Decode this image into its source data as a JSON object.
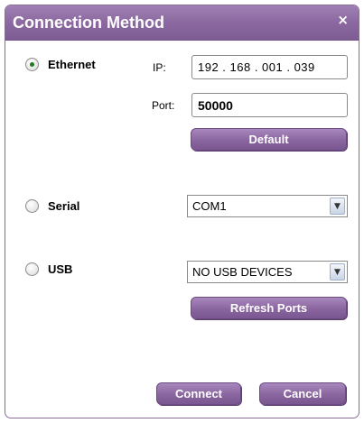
{
  "dialog": {
    "title": "Connection Method",
    "close_glyph": "×"
  },
  "ethernet": {
    "label": "Ethernet",
    "selected": true,
    "ip_label": "IP:",
    "ip_value": "192 . 168 . 001 . 039",
    "port_label": "Port:",
    "port_value": "50000",
    "default_button": "Default"
  },
  "serial": {
    "label": "Serial",
    "selected": false,
    "port_value": "COM1"
  },
  "usb": {
    "label": "USB",
    "selected": false,
    "device_value": "NO USB DEVICES",
    "refresh_button": "Refresh Ports"
  },
  "footer": {
    "connect_button": "Connect",
    "cancel_button": "Cancel"
  },
  "icons": {
    "dropdown": "chevron-down-icon",
    "close": "close-icon"
  },
  "colors": {
    "accent": "#8a679f",
    "radio_selected": "#1f7a1f"
  }
}
